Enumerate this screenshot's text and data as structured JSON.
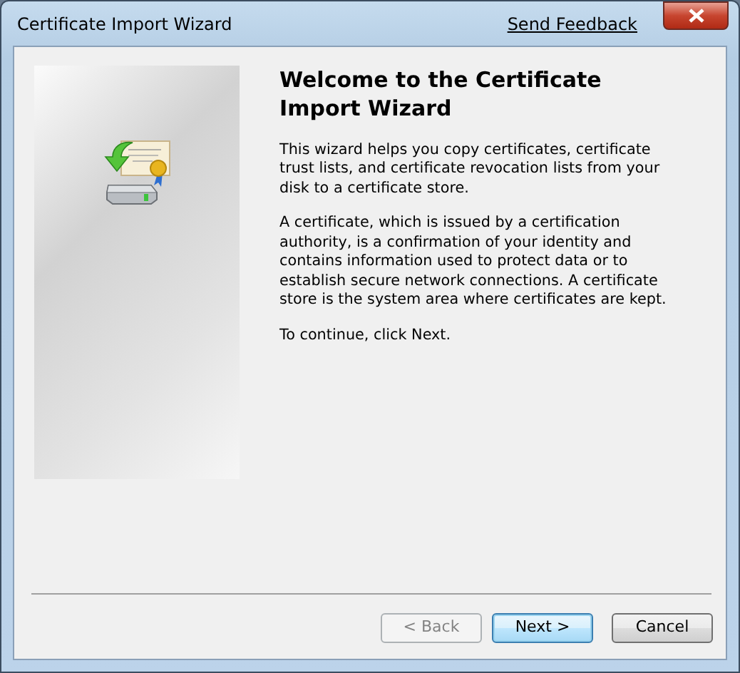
{
  "window": {
    "title": "Certificate Import Wizard",
    "feedback_link": "Send Feedback"
  },
  "heading": "Welcome to the Certificate Import Wizard",
  "paragraphs": [
    "This wizard helps you copy certificates, certificate trust lists, and certificate revocation lists from your disk to a certificate store.",
    "A certificate, which is issued by a certification authority, is a confirmation of your identity and contains information used to protect data or to establish secure network connections. A certificate store is the system area where certificates are kept.",
    "To continue, click Next."
  ],
  "buttons": [
    {
      "label": "< Back",
      "disabled": true,
      "default": false
    },
    {
      "label": "Next >",
      "disabled": false,
      "default": true
    },
    {
      "label": "Cancel",
      "disabled": false,
      "default": false
    }
  ]
}
